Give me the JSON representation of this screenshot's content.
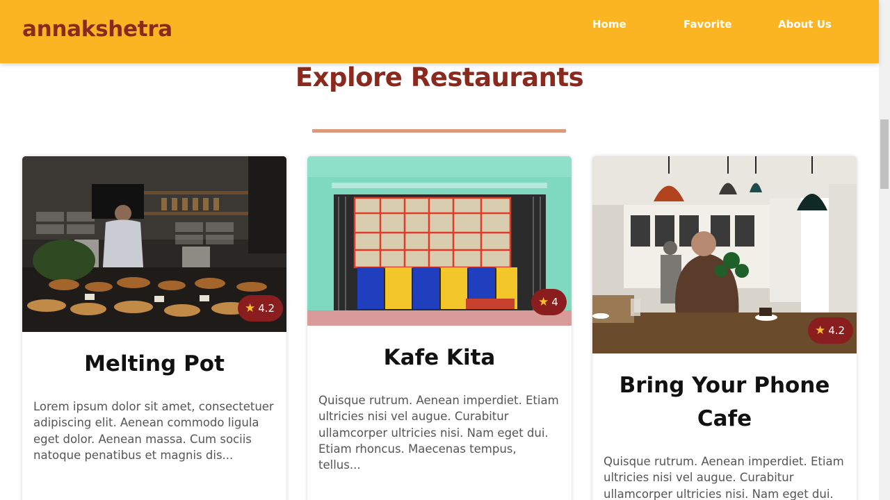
{
  "brand": "annakshetra",
  "nav": {
    "home": "Home",
    "favorite": "Favorite",
    "about": "About Us"
  },
  "page": {
    "title": "Explore Restaurants"
  },
  "colors": {
    "header": "#FBB523",
    "accent": "#8A2A1E",
    "badge": "#8A1E1E",
    "rule": "#DB9A7D"
  },
  "cards": [
    {
      "name": "Melting Pot",
      "rating": "4.2",
      "rating_icon": "star-icon",
      "photo": "cafe counter with barista",
      "description": "Lorem ipsum dolor sit amet, consectetuer adipiscing elit. Aenean commodo ligula eget dolor. Aenean massa. Cum sociis natoque penatibus et magnis dis..."
    },
    {
      "name": "Kafe Kita",
      "rating": "4",
      "rating_icon": "star-icon",
      "photo": "turquoise storefront with colorful window",
      "description": "Quisque rutrum. Aenean imperdiet. Etiam ultricies nisi vel augue. Curabitur ullamcorper ultricies nisi. Nam eget dui. Etiam rhoncus. Maecenas tempus, tellus..."
    },
    {
      "name": "Bring Your Phone Cafe",
      "rating": "4.2",
      "rating_icon": "star-icon",
      "photo": "man seated in cafe under pendant lamps",
      "description": "Quisque rutrum. Aenean imperdiet. Etiam ultricies nisi vel augue. Curabitur ullamcorper ultricies nisi. Nam eget dui."
    }
  ]
}
